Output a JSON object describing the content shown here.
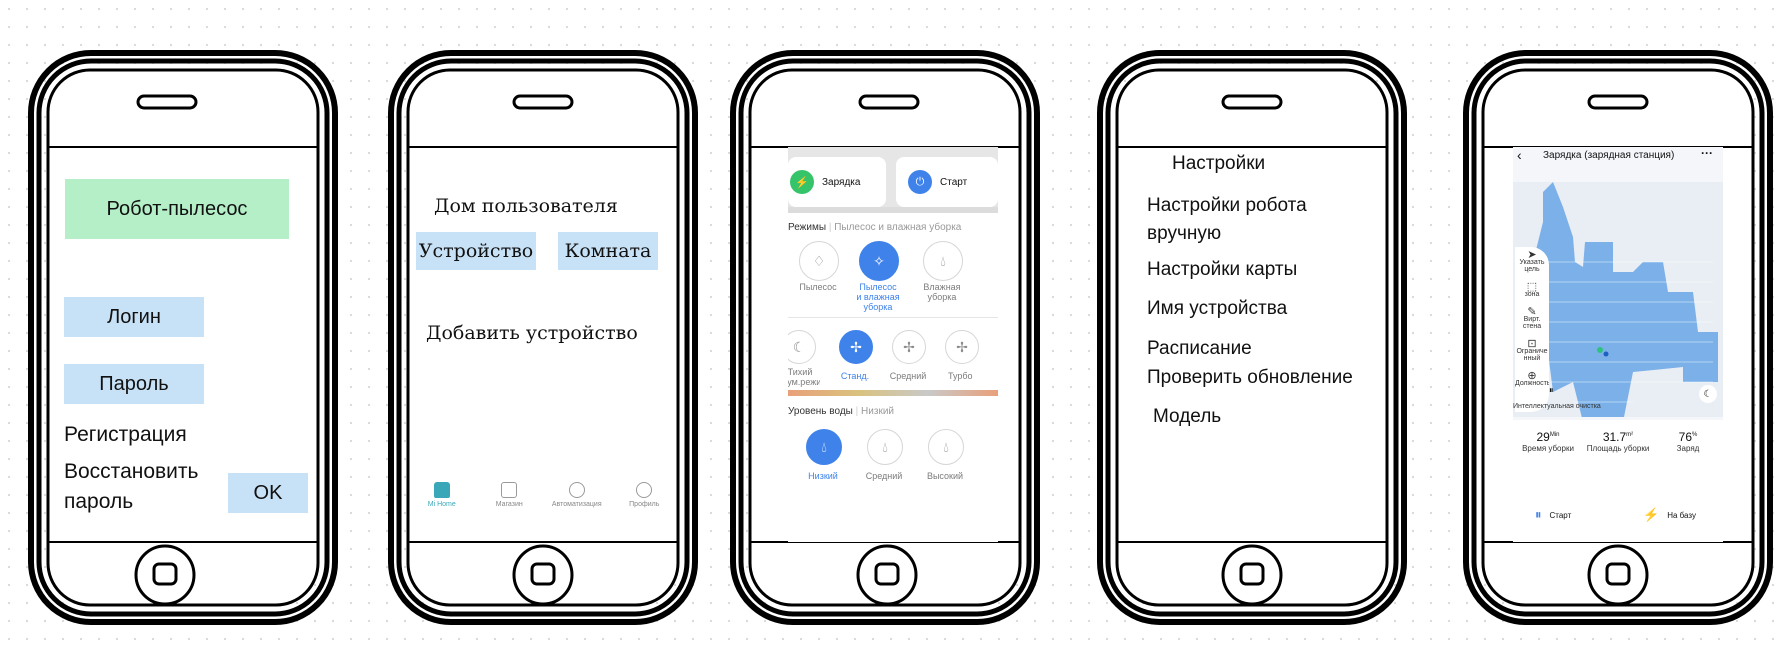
{
  "phone1": {
    "title": "Робот-пылесос",
    "login": "Логин",
    "password": "Пароль",
    "register": "Регистрация",
    "restore_line1": "Восстановить",
    "restore_line2": "пароль",
    "ok": "OK"
  },
  "phone2": {
    "heading": "Дом пользователя",
    "device_tab": "Устройство",
    "room_tab": "Комната",
    "add_device": "Добавить устройство",
    "tabbar": [
      "Mi Home",
      "Магазин",
      "Автоматизация",
      "Профиль"
    ]
  },
  "phone3": {
    "charge_label": "Зарядка",
    "start_label": "Старт",
    "modes_title": "Режимы",
    "modes_current": "Пылесос и влажная уборка",
    "modes": [
      "Пылесос",
      "Пылесос\nи влажная\nуборка",
      "Влажная\nуборка"
    ],
    "power": [
      "Тихий\nшум.режи\nм",
      "Станд.",
      "Средний",
      "Турбо"
    ],
    "water_title": "Уровень воды",
    "water_current": "Низкий",
    "water": [
      "Низкий",
      "Средний",
      "Высокий"
    ],
    "accent": "#3e82ea"
  },
  "phone4": {
    "title": "Настройки",
    "items": [
      "Настройки робота",
      "вручную",
      "Настройки карты",
      "Имя устройства",
      "Расписание",
      "Проверить обновление",
      "Модель"
    ]
  },
  "phone5": {
    "title": "Зарядка (зарядная станция)",
    "tools": [
      "Указать\nцель",
      "зона",
      "Вирт.\nстена",
      "Ограниче\nнный",
      "Должность"
    ],
    "clean_label": "Интеллектуальная очистка",
    "stats": [
      {
        "value": "29",
        "unit": "Min",
        "label": "Время уборки"
      },
      {
        "value": "31.7",
        "unit": "m²",
        "label": "Площадь уборки"
      },
      {
        "value": "76",
        "unit": "%",
        "label": "Заряд"
      }
    ],
    "start": "Старт",
    "dock": "На базу",
    "map_color": "#6fa8e8"
  }
}
